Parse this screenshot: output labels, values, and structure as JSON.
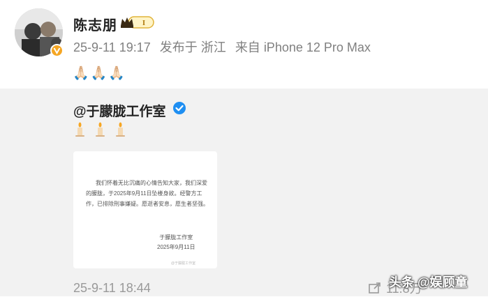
{
  "post": {
    "author": "陈志朋",
    "vip_level": "I",
    "time": "25-9-11 19:17",
    "location": "发布于 浙江",
    "device": "来自 iPhone 12 Pro Max",
    "text": "🙏🏻🙏🏻🙏🏻"
  },
  "repost": {
    "author": "@于朦胧工作室",
    "candles_count": 3,
    "statement": {
      "body": "我们怀着无比沉痛的心情告知大家，我们深爱的朦胧，于2025年9月11日坠楼身故。经警方工作，已排除刑事嫌疑。愿逝者安息，愿生者坚强。",
      "signature": "于朦胧工作室",
      "date": "2025年9月11日",
      "watermark": "@于朦胧工作室"
    },
    "time": "25-9-11 18:44",
    "share_count": "11.8万"
  },
  "watermark": {
    "text": "头条 @娱顾童"
  },
  "colors": {
    "verify_orange": "#f5a623",
    "verify_blue": "#1f8ff2",
    "repost_bg": "#f2f2f2"
  }
}
